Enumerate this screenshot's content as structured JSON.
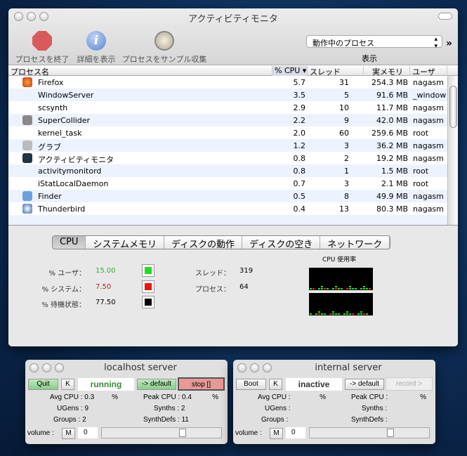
{
  "activity_monitor": {
    "title": "アクティビティモニタ",
    "toolbar": {
      "quit": "プロセスを終了",
      "info": "詳細を表示",
      "sample": "プロセスをサンプル収集",
      "show_label": "表示",
      "filter": "動作中のプロセス",
      "more": "»"
    },
    "columns": {
      "name": "プロセス名",
      "cpu": "% CPU ▾",
      "threads": "スレッド",
      "memory": "実メモリ",
      "user": "ユーザ"
    },
    "processes": [
      {
        "name": "Firefox",
        "cpu": "5.7",
        "threads": "31",
        "memory": "254.3 MB",
        "user": "nagasm",
        "icon": "firefox-icon"
      },
      {
        "name": "WindowServer",
        "cpu": "3.5",
        "threads": "5",
        "memory": "91.6 MB",
        "user": "_window",
        "icon": ""
      },
      {
        "name": "scsynth",
        "cpu": "2.9",
        "threads": "10",
        "memory": "11.7 MB",
        "user": "nagasm",
        "icon": ""
      },
      {
        "name": "SuperCollider",
        "cpu": "2.2",
        "threads": "9",
        "memory": "42.0 MB",
        "user": "nagasm",
        "icon": "supercollider-icon"
      },
      {
        "name": "kernel_task",
        "cpu": "2.0",
        "threads": "60",
        "memory": "259.6 MB",
        "user": "root",
        "icon": ""
      },
      {
        "name": "グラブ",
        "cpu": "1.2",
        "threads": "3",
        "memory": "36.2 MB",
        "user": "nagasm",
        "icon": "grab-icon"
      },
      {
        "name": "アクティビティモニタ",
        "cpu": "0.8",
        "threads": "2",
        "memory": "19.2 MB",
        "user": "nagasm",
        "icon": "activity-monitor-icon"
      },
      {
        "name": "activitymonitord",
        "cpu": "0.8",
        "threads": "1",
        "memory": "1.5 MB",
        "user": "root",
        "icon": ""
      },
      {
        "name": "iStatLocalDaemon",
        "cpu": "0.7",
        "threads": "3",
        "memory": "2.1 MB",
        "user": "root",
        "icon": ""
      },
      {
        "name": "Finder",
        "cpu": "0.5",
        "threads": "8",
        "memory": "49.9 MB",
        "user": "nagasm",
        "icon": "finder-icon"
      },
      {
        "name": "Thunderbird",
        "cpu": "0.4",
        "threads": "13",
        "memory": "80.3 MB",
        "user": "nagasm",
        "icon": "thunderbird-icon"
      }
    ],
    "tabs": [
      "CPU",
      "システムメモリ",
      "ディスクの動作",
      "ディスクの空き",
      "ネットワーク"
    ],
    "active_tab": "CPU",
    "cpu": {
      "user_label": "% ユーザ：",
      "user_value": "15.00",
      "user_color": "#22dd22",
      "system_label": "% システム：",
      "system_value": "7.50",
      "system_color": "#ee1111",
      "idle_label": "% 待機状態：",
      "idle_value": "77.50",
      "idle_color": "#000000",
      "threads_label": "スレッド：",
      "threads_value": "319",
      "processes_label": "プロセス：",
      "processes_value": "64",
      "graph_title": "CPU 使用率"
    }
  },
  "localhost": {
    "title": "localhost server",
    "quit": "Quit",
    "k": "K",
    "status": "running",
    "default": "-> default",
    "record": "stop []",
    "avg_cpu": "Avg CPU : 0.3",
    "avg_pct": "%",
    "peak_cpu": "Peak CPU : 0.4",
    "peak_pct": "%",
    "ugens": "UGens : 9",
    "synths": "Synths : 2",
    "groups": "Groups : 2",
    "synthdefs": "SynthDefs : 11",
    "volume": "volume :",
    "mute": "M",
    "volume_value": "0"
  },
  "internal": {
    "title": "internal server",
    "quit": "Boot",
    "k": "K",
    "status": "inactive",
    "default": "-> default",
    "record": "record >",
    "avg_cpu": "Avg CPU :",
    "avg_pct": "%",
    "peak_cpu": "Peak CPU :",
    "peak_pct": "%",
    "ugens": "UGens :",
    "synths": "Synths :",
    "groups": "Groups :",
    "synthdefs": "SynthDefs :",
    "volume": "volume :",
    "mute": "M",
    "volume_value": "0"
  }
}
